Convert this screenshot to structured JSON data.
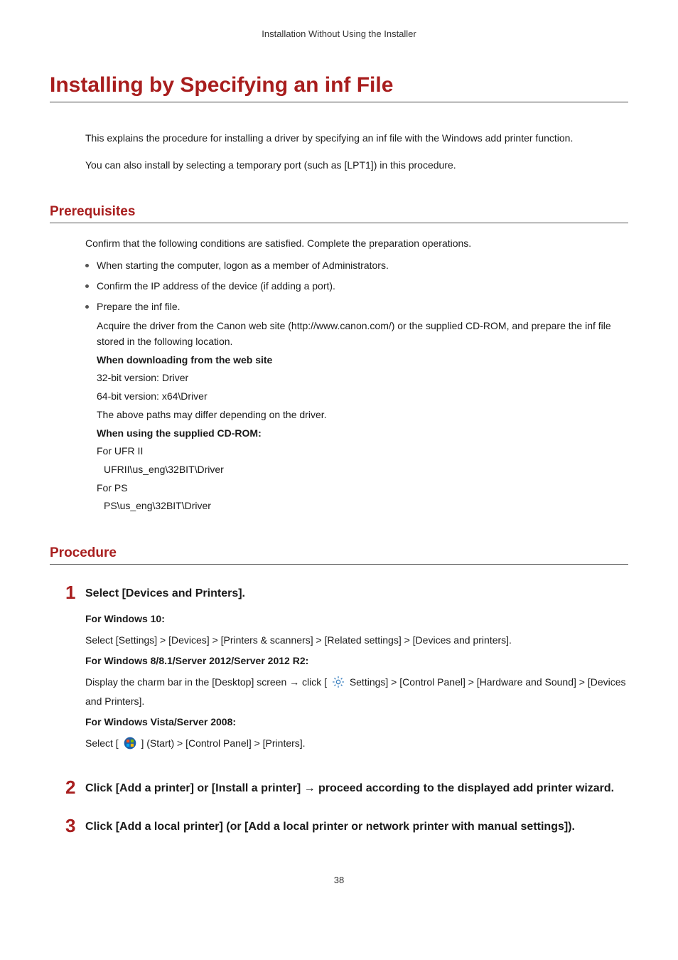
{
  "running_head": "Installation Without Using the Installer",
  "title": "Installing by Specifying an inf File",
  "intro": {
    "p1": "This explains the procedure for installing a driver by specifying an inf file with the Windows add printer function.",
    "p2": "You can also install by selecting a temporary port (such as [LPT1]) in this procedure."
  },
  "prerequisites": {
    "heading": "Prerequisites",
    "lead": "Confirm that the following conditions are satisfied. Complete the preparation operations.",
    "items": {
      "i1": "When starting the computer, logon as a member of Administrators.",
      "i2": "Confirm the IP address of the device (if adding a port).",
      "i3": "Prepare the inf file."
    },
    "detail": {
      "p1": "Acquire the driver from the Canon web site (http://www.canon.com/) or the supplied CD-ROM, and prepare the inf file stored in the following location.",
      "h1": "When downloading from the web site",
      "l1": "32-bit version: Driver",
      "l2": "64-bit version: x64\\Driver",
      "l3": "The above paths may differ depending on the driver.",
      "h2": "When using the supplied CD-ROM:",
      "l4": "For UFR II",
      "l5": "UFRII\\us_eng\\32BIT\\Driver",
      "l6": "For PS",
      "l7": "PS\\us_eng\\32BIT\\Driver"
    }
  },
  "procedure": {
    "heading": "Procedure",
    "steps": {
      "s1": {
        "num": "1",
        "title": "Select [Devices and Printers].",
        "win10_h": "For Windows 10:",
        "win10_p": "Select [Settings] > [Devices] > [Printers & scanners] > [Related settings] > [Devices and printers].",
        "win8_h": "For Windows 8/8.1/Server 2012/Server 2012 R2:",
        "win8_pre": "Display the charm bar in the [Desktop] screen → click [",
        "win8_post": " Settings] > [Control Panel] > [Hardware and Sound] > [Devices and Printers].",
        "vista_h": "For Windows Vista/Server 2008:",
        "vista_pre": "Select [",
        "vista_post": "] (Start) > [Control Panel] > [Printers]."
      },
      "s2": {
        "num": "2",
        "title": "Click [Add a printer] or [Install a printer] → proceed according to the displayed add printer wizard."
      },
      "s3": {
        "num": "3",
        "title": "Click [Add a local printer] (or [Add a local printer or network printer with manual settings])."
      }
    }
  },
  "page_number": "38"
}
